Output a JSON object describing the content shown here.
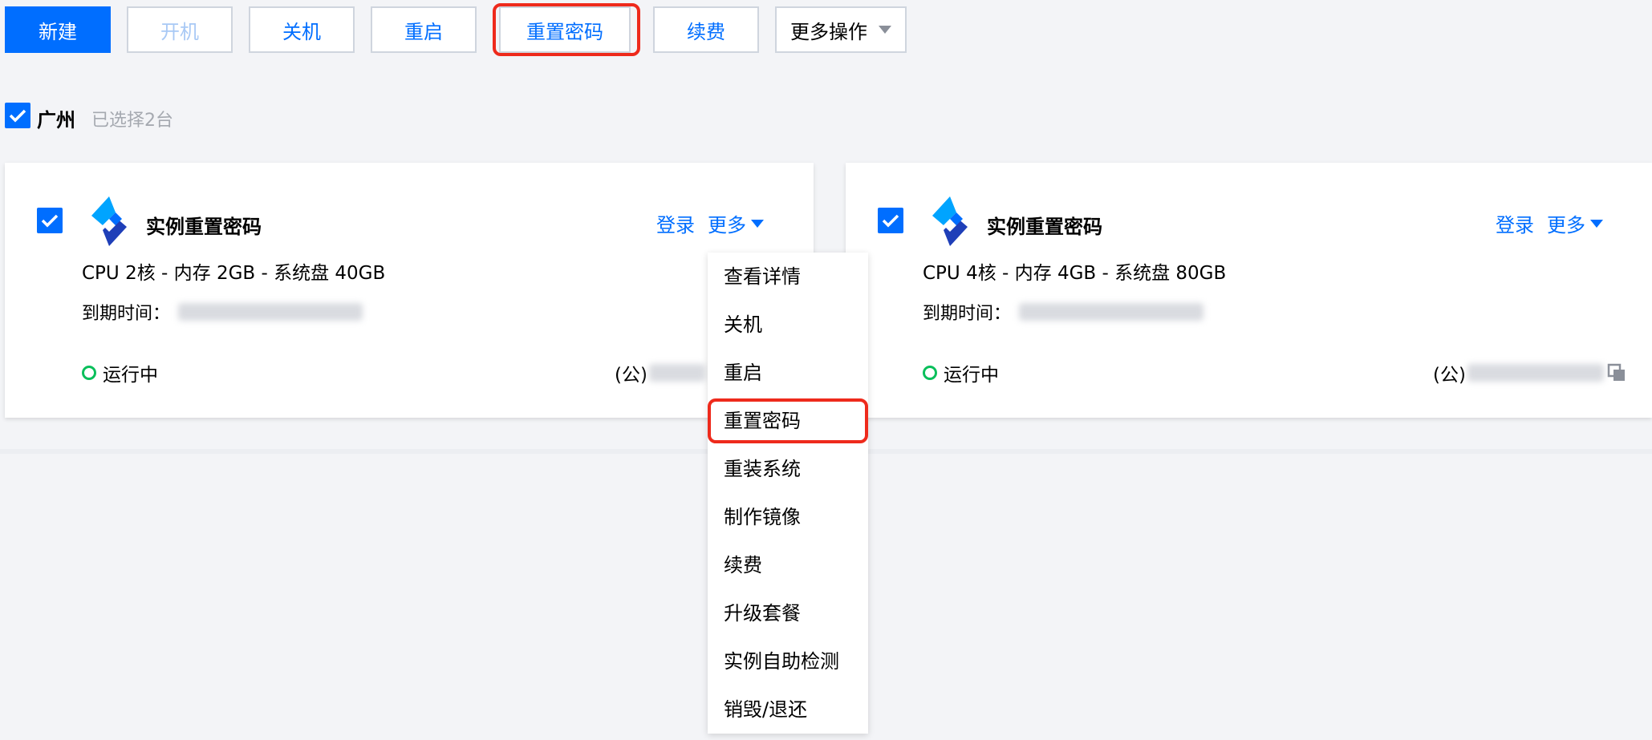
{
  "toolbar": {
    "new_label": "新建",
    "start_label": "开机",
    "shutdown_label": "关机",
    "restart_label": "重启",
    "reset_password_label": "重置密码",
    "renew_label": "续费",
    "more_actions_label": "更多操作"
  },
  "region": {
    "name": "广州",
    "selected_count": "已选择2台"
  },
  "instances": [
    {
      "name": "实例重置密码",
      "spec": "CPU 2核 - 内存 2GB - 系统盘 40GB",
      "expire_label": "到期时间：",
      "status": "运行中",
      "ip_prefix": "(公)",
      "login_label": "登录",
      "more_label": "更多"
    },
    {
      "name": "实例重置密码",
      "spec": "CPU 4核 - 内存 4GB - 系统盘 80GB",
      "expire_label": "到期时间：",
      "status": "运行中",
      "ip_prefix": "(公)",
      "login_label": "登录",
      "more_label": "更多"
    }
  ],
  "more_menu": {
    "items": [
      "查看详情",
      "关机",
      "重启",
      "重置密码",
      "重装系统",
      "制作镜像",
      "续费",
      "升级套餐",
      "实例自助检测",
      "销毁/退还"
    ]
  },
  "colors": {
    "primary": "#006eff",
    "highlight": "#ee2a1c",
    "status_running": "#0abf5b"
  }
}
